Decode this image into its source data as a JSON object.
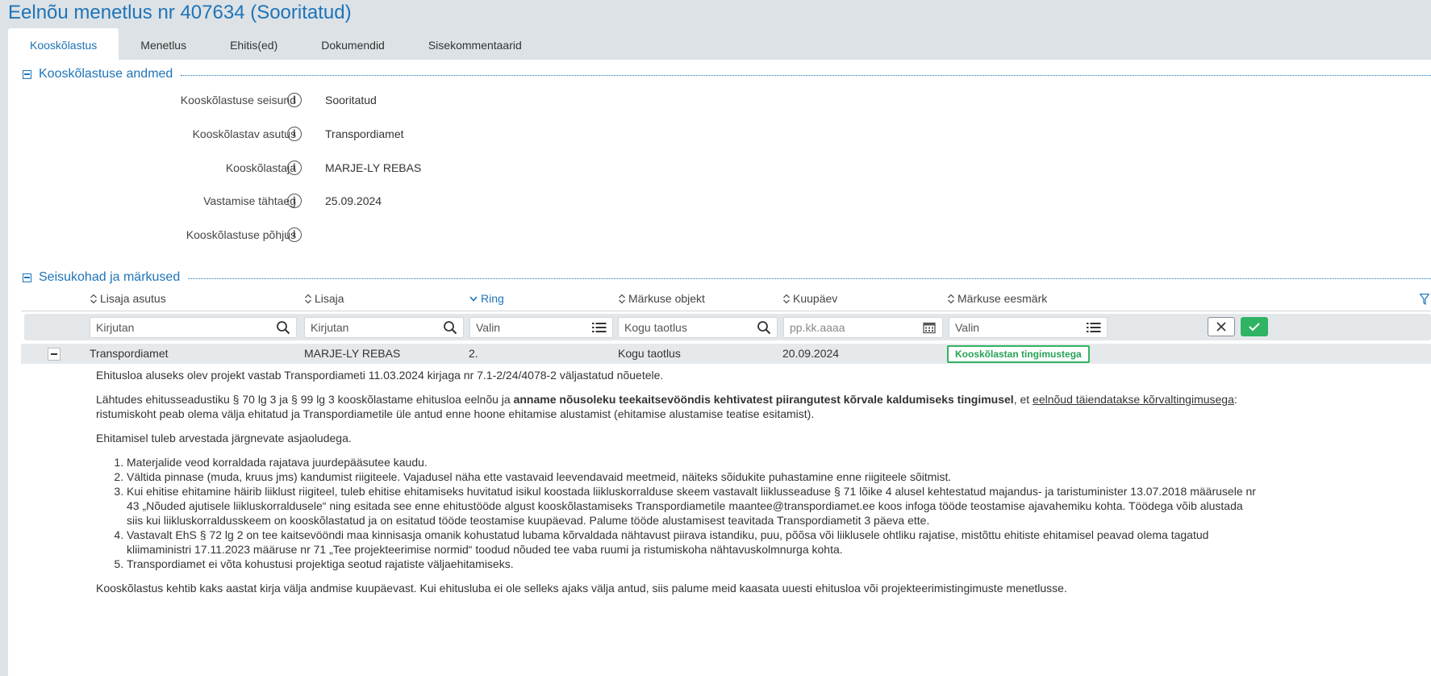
{
  "page": {
    "title": "Eelnõu menetlus nr 407634 (Sooritatud)"
  },
  "tabs": [
    {
      "label": "Kooskõlastus",
      "active": true
    },
    {
      "label": "Menetlus"
    },
    {
      "label": "Ehitis(ed)"
    },
    {
      "label": "Dokumendid"
    },
    {
      "label": "Sisekommentaarid"
    }
  ],
  "section1": {
    "title": "Kooskõlastuse andmed",
    "fields": [
      {
        "label": "Kooskõlastuse seisund",
        "value": "Sooritatud"
      },
      {
        "label": "Kooskõlastav asutus",
        "value": "Transpordiamet"
      },
      {
        "label": "Kooskõlastaja",
        "value": "MARJE-LY REBAS"
      },
      {
        "label": "Vastamise tähtaeg",
        "value": "25.09.2024"
      },
      {
        "label": "Kooskõlastuse põhjus",
        "value": ""
      }
    ]
  },
  "section2": {
    "title": "Seisukohad ja märkused",
    "columns": [
      {
        "label": "Lisaja asutus"
      },
      {
        "label": "Lisaja"
      },
      {
        "label": "Ring",
        "active": true
      },
      {
        "label": "Märkuse objekt"
      },
      {
        "label": "Kuupäev"
      },
      {
        "label": "Märkuse eesmärk"
      }
    ],
    "filters": [
      {
        "value": "Kirjutan",
        "icon": "search-icon"
      },
      {
        "value": "Kirjutan",
        "icon": "search-icon"
      },
      {
        "value": "Valin",
        "icon": "list-icon"
      },
      {
        "value": "Kogu taotlus",
        "icon": "search-icon"
      },
      {
        "value": "",
        "placeholder": "pp.kk.aaaa",
        "icon": "calendar-icon"
      },
      {
        "value": "Valin",
        "icon": "list-icon"
      }
    ],
    "row": {
      "asutus": "Transpordiamet",
      "lisaja": "MARJE-LY REBAS",
      "ring": "2.",
      "objekt": "Kogu taotlus",
      "kuupaev": "20.09.2024",
      "eesmark": "Kooskõlastan tingimustega"
    },
    "detail": {
      "p1": "Ehitusloa aluseks olev projekt vastab Transpordiameti 11.03.2024 kirjaga nr 7.1-2/24/4078-2 väljastatud nõuetele.",
      "p2_a": "Lähtudes ehitusseadustiku § 70 lg 3 ja § 99 lg 3 kooskõlastame ehitusloa eelnõu ja ",
      "p2_b": "anname nõusoleku teekaitsevööndis kehtivatest piirangutest kõrvale kaldumiseks tingimusel",
      "p2_c": ", et ",
      "p2_d": "eelnõud täiendatakse kõrvaltingimusega",
      "p2_e": ": ristumiskoht peab olema välja ehitatud ja Transpordiametile üle antud enne hoone ehitamise alustamist (ehitamise alustamise teatise esitamist).",
      "p3": "Ehitamisel tuleb arvestada järgnevate asjaoludega.",
      "items": [
        "Materjalide veod korraldada rajatava juurdepääsutee kaudu.",
        "Vältida pinnase (muda, kruus jms) kandumist riigiteele. Vajadusel näha ette vastavaid leevendavaid meetmeid, näiteks sõidukite puhastamine enne riigiteele sõitmist.",
        "Kui ehitise ehitamine häirib liiklust riigiteel, tuleb ehitise ehitamiseks huvitatud isikul koostada liikluskorralduse skeem vastavalt liiklusseaduse § 71 lõike 4 alusel kehtestatud majandus- ja taristuminister 13.07.2018 määrusele nr 43 „Nõuded ajutisele liikluskorraldusele“ ning esitada see enne ehitustööde algust kooskõlastamiseks Transpordiametile maantee@transpordiamet.ee koos infoga tööde teostamise ajavahemiku kohta. Töödega võib alustada siis kui liikluskorraldusskeem on kooskõlastatud ja on esitatud tööde teostamise kuupäevad. Palume tööde alustamisest teavitada Transpordiametit 3 päeva ette.",
        "Vastavalt EhS § 72 lg 2 on tee kaitsevööndi maa kinnisasja omanik kohustatud lubama kõrvaldada nähtavust piirava istandiku, puu, põõsa või liiklusele ohtliku rajatise, mistõttu ehitiste ehitamisel peavad olema tagatud kliimaministri 17.11.2023 määruse nr 71 „Tee projekteerimise normid“ toodud nõuded tee vaba ruumi ja ristumiskoha nähtavuskolmnurga kohta.",
        "Transpordiamet ei võta kohustusi projektiga seotud rajatiste väljaehitamiseks."
      ],
      "p4": "Kooskõlastus kehtib kaks aastat kirja välja andmise kuupäevast. Kui ehitusluba ei ole selleks ajaks välja antud, siis palume meid kaasata uuesti ehitusloa või projekteerimistingimuste menetlusse."
    }
  }
}
